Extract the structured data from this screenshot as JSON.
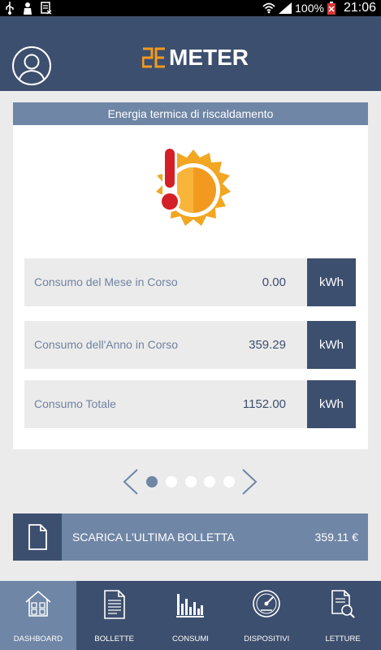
{
  "status_bar": {
    "battery": "100%",
    "time": "21:06",
    "icons": [
      "usb-icon",
      "person-silhouette-icon",
      "sim-icon",
      "wifi-icon",
      "signal-icon",
      "battery-icon"
    ]
  },
  "header": {
    "logo_text": "METER",
    "logo_mark": "2E",
    "avatar_icon": "user-icon"
  },
  "card": {
    "title": "Energia termica di riscaldamento",
    "illustration_icon": "sun-thermometer-icon",
    "rows": [
      {
        "label": "Consumo del Mese in Corso",
        "value": "0.00",
        "unit": "kWh"
      },
      {
        "label": "Consumo dell'Anno in Corso",
        "value": "359.29",
        "unit": "kWh"
      },
      {
        "label": "Consumo Totale",
        "value": "1152.00",
        "unit": "kWh"
      }
    ]
  },
  "pager": {
    "pages": 5,
    "active_index": 0,
    "prev_icon": "chevron-left-icon",
    "next_icon": "chevron-right-icon"
  },
  "bill": {
    "label": "SCARICA L'ULTIMA BOLLETTA",
    "amount": "359.11 €",
    "icon": "document-icon"
  },
  "nav": {
    "items": [
      {
        "label": "DASHBOARD",
        "icon": "house-icon",
        "active": true
      },
      {
        "label": "BOLLETTE",
        "icon": "invoice-icon",
        "active": false
      },
      {
        "label": "CONSUMI",
        "icon": "bar-chart-icon",
        "active": false
      },
      {
        "label": "DISPOSITIVI",
        "icon": "gauge-icon",
        "active": false
      },
      {
        "label": "LETTURE",
        "icon": "document-search-icon",
        "active": false
      }
    ]
  },
  "colors": {
    "header": "#3d4f6e",
    "accent": "#6f86a6",
    "logo_orange": "#f29a1f",
    "background": "#ebebeb"
  }
}
